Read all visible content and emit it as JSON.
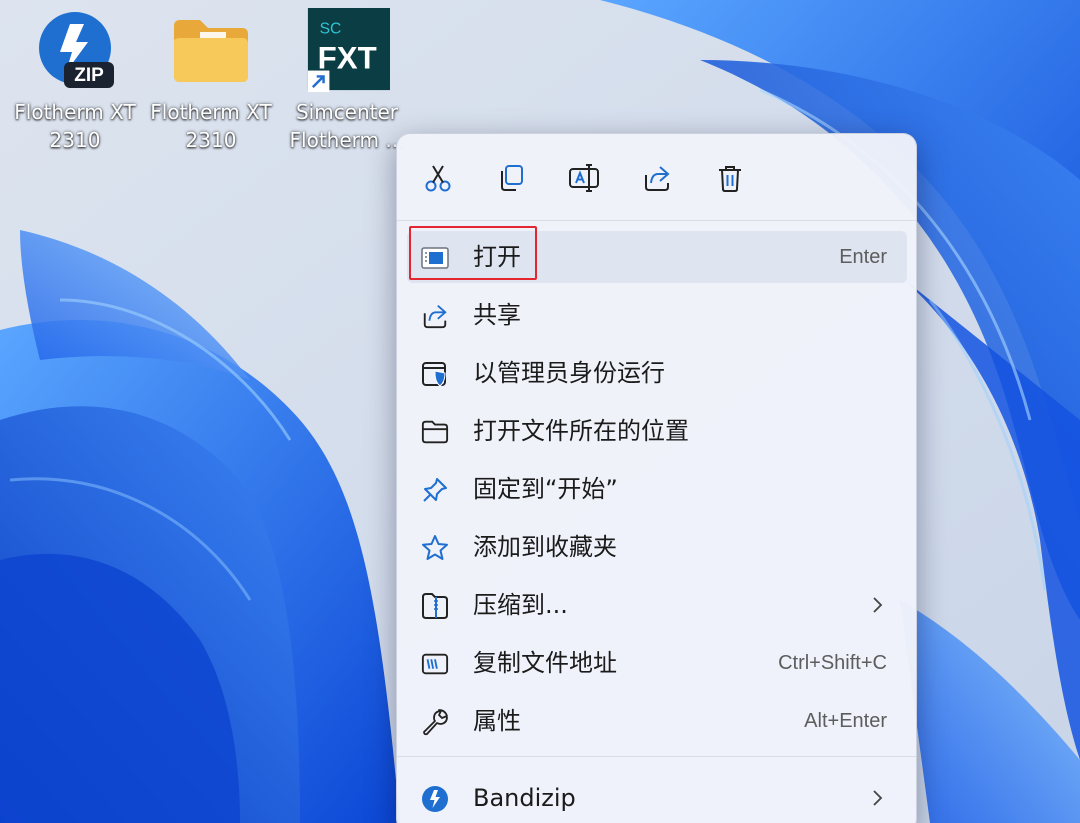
{
  "desktop": {
    "icons": [
      {
        "line1": "Flotherm XT",
        "line2": "2310",
        "icon": "bandizip-zip-icon"
      },
      {
        "line1": "Flotherm XT",
        "line2": "2310",
        "icon": "folder-icon"
      },
      {
        "line1": "Simcenter",
        "line2": "Flotherm ...",
        "icon": "simcenter-fxt-shortcut-icon",
        "glyph_top": "SC",
        "glyph_main": "FXT"
      }
    ],
    "zip_badge": "ZIP"
  },
  "context_menu": {
    "quick_actions": [
      {
        "name": "cut",
        "icon": "scissors-icon"
      },
      {
        "name": "copy",
        "icon": "copy-icon"
      },
      {
        "name": "rename",
        "icon": "rename-icon"
      },
      {
        "name": "share",
        "icon": "share-icon"
      },
      {
        "name": "delete",
        "icon": "trash-icon"
      }
    ],
    "items": [
      {
        "label": "打开",
        "shortcut": "Enter",
        "icon": "app-window-icon"
      },
      {
        "label": "共享",
        "shortcut": "",
        "icon": "share-icon"
      },
      {
        "label": "以管理员身份运行",
        "shortcut": "",
        "icon": "admin-shield-icon"
      },
      {
        "label": "打开文件所在的位置",
        "shortcut": "",
        "icon": "folder-outline-icon"
      },
      {
        "label": "固定到“开始”",
        "shortcut": "",
        "icon": "pin-icon"
      },
      {
        "label": "添加到收藏夹",
        "shortcut": "",
        "icon": "star-icon"
      },
      {
        "label": "压缩到...",
        "shortcut": "",
        "icon": "zip-folder-icon",
        "submenu": true
      },
      {
        "label": "复制文件地址",
        "shortcut": "Ctrl+Shift+C",
        "icon": "copy-path-icon"
      },
      {
        "label": "属性",
        "shortcut": "Alt+Enter",
        "icon": "wrench-icon"
      },
      {
        "label": "Bandizip",
        "shortcut": "",
        "icon": "bandizip-icon",
        "submenu": true
      }
    ]
  },
  "colors": {
    "accent": "#1f6fd1",
    "highlight_box": "#e3262f",
    "menu_bg": "#f0f3fa"
  }
}
